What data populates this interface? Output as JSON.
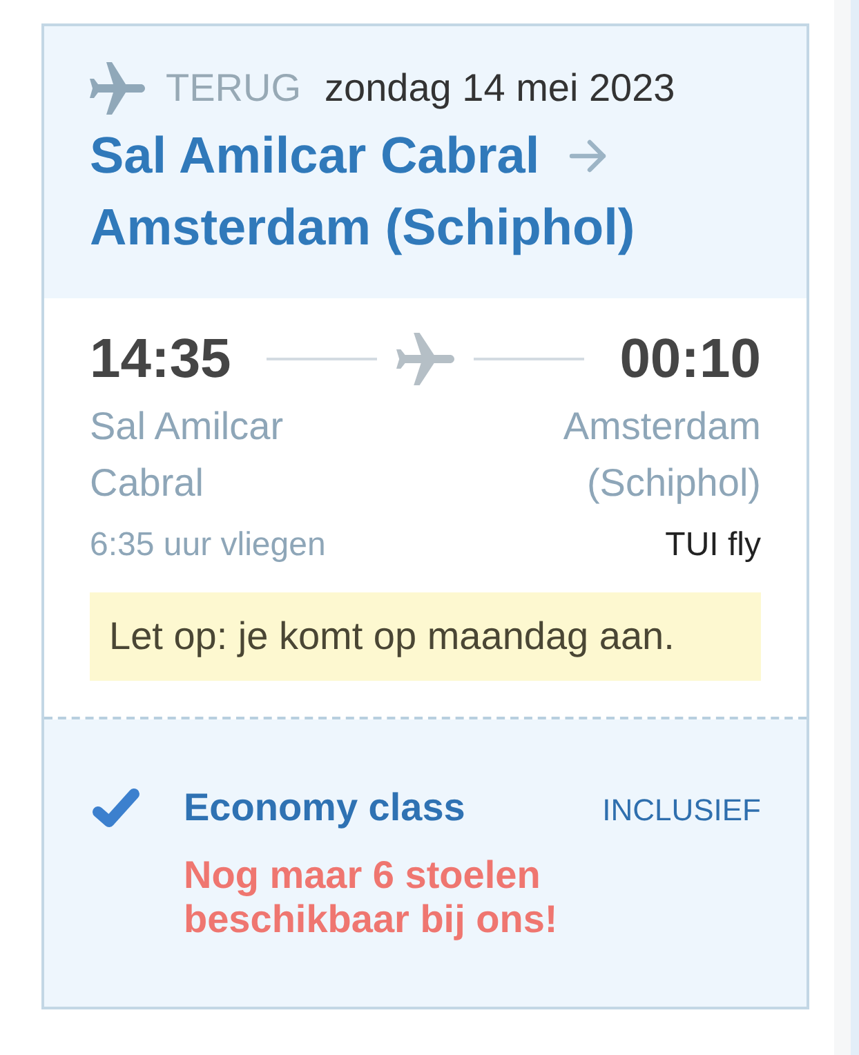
{
  "header": {
    "direction": "TERUG",
    "date": "zondag 14 mei 2023",
    "origin": "Sal Amilcar Cabral",
    "destination": "Amsterdam (Schiphol)"
  },
  "flight": {
    "departure_time": "14:35",
    "arrival_time": "00:10",
    "departure_airport": "Sal Amilcar Cabral",
    "arrival_airport": "Amsterdam (Schiphol)",
    "duration": "6:35 uur vliegen",
    "airline": "TUI fly",
    "notice": "Let op: je komt op maandag aan."
  },
  "fare": {
    "checked": true,
    "cabin_class": "Economy class",
    "price_label": "INCLUSIEF",
    "availability": "Nog maar 6 stoelen beschikbaar bij ons!"
  }
}
